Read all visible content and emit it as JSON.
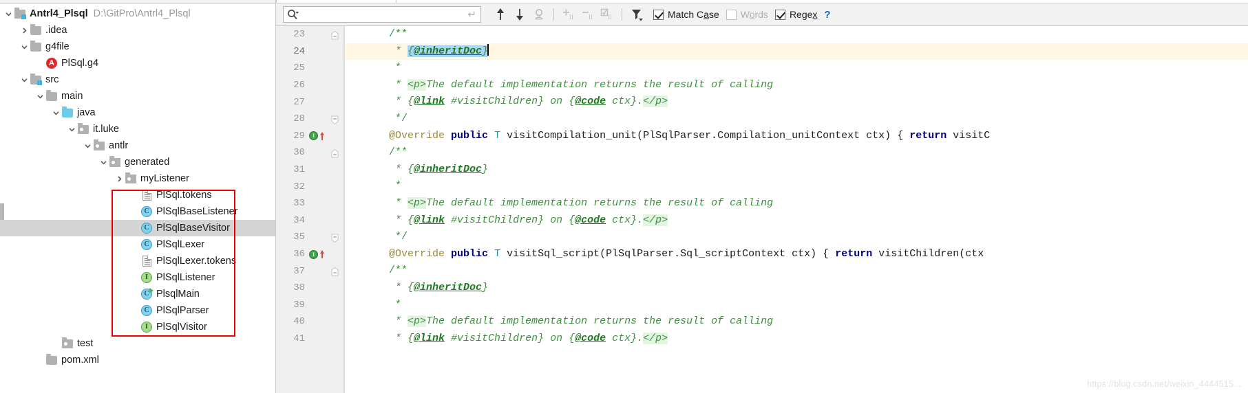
{
  "sidebar": {
    "tree": [
      {
        "depth": 0,
        "twisty": "expanded",
        "icon": "module-icon",
        "label": "Antrl4_Plsql",
        "bold": true,
        "path": "D:\\GitPro\\Antrl4_Plsql",
        "selected": false
      },
      {
        "depth": 1,
        "twisty": "collapsed",
        "icon": "folder-icon",
        "label": ".idea",
        "bold": false,
        "path": "",
        "selected": false
      },
      {
        "depth": 1,
        "twisty": "expanded",
        "icon": "folder-icon",
        "label": "g4file",
        "bold": false,
        "path": "",
        "selected": false
      },
      {
        "depth": 2,
        "twisty": "none",
        "icon": "antlr-file-icon",
        "label": "PlSql.g4",
        "bold": false,
        "path": "",
        "selected": false
      },
      {
        "depth": 1,
        "twisty": "expanded",
        "icon": "source-folder-icon",
        "label": "src",
        "bold": false,
        "path": "",
        "selected": false
      },
      {
        "depth": 2,
        "twisty": "expanded",
        "icon": "folder-icon",
        "label": "main",
        "bold": false,
        "path": "",
        "selected": false
      },
      {
        "depth": 3,
        "twisty": "expanded",
        "icon": "java-source-folder-icon",
        "label": "java",
        "bold": false,
        "path": "",
        "selected": false
      },
      {
        "depth": 4,
        "twisty": "expanded",
        "icon": "package-icon",
        "label": "it.luke",
        "bold": false,
        "path": "",
        "selected": false
      },
      {
        "depth": 5,
        "twisty": "expanded",
        "icon": "package-icon",
        "label": "antlr",
        "bold": false,
        "path": "",
        "selected": false
      },
      {
        "depth": 6,
        "twisty": "expanded",
        "icon": "package-icon",
        "label": "generated",
        "bold": false,
        "path": "",
        "selected": false
      },
      {
        "depth": 7,
        "twisty": "collapsed",
        "icon": "package-icon",
        "label": "myListener",
        "bold": false,
        "path": "",
        "selected": false
      },
      {
        "depth": 8,
        "twisty": "none",
        "icon": "tokens-file-icon",
        "label": "PlSql.tokens",
        "bold": false,
        "path": "",
        "selected": false
      },
      {
        "depth": 8,
        "twisty": "none",
        "icon": "java-class-icon",
        "label": "PlSqlBaseListener",
        "bold": false,
        "path": "",
        "selected": false
      },
      {
        "depth": 8,
        "twisty": "none",
        "icon": "java-class-icon",
        "label": "PlSqlBaseVisitor",
        "bold": false,
        "path": "",
        "selected": true
      },
      {
        "depth": 8,
        "twisty": "none",
        "icon": "java-class-icon",
        "label": "PlSqlLexer",
        "bold": false,
        "path": "",
        "selected": false
      },
      {
        "depth": 8,
        "twisty": "none",
        "icon": "tokens-file-icon",
        "label": "PlSqlLexer.tokens",
        "bold": false,
        "path": "",
        "selected": false
      },
      {
        "depth": 8,
        "twisty": "none",
        "icon": "java-interface-icon",
        "label": "PlSqlListener",
        "bold": false,
        "path": "",
        "selected": false
      },
      {
        "depth": 8,
        "twisty": "none",
        "icon": "java-runnable-class-icon",
        "label": "PlsqlMain",
        "bold": false,
        "path": "",
        "selected": false
      },
      {
        "depth": 8,
        "twisty": "none",
        "icon": "java-class-icon",
        "label": "PlSqlParser",
        "bold": false,
        "path": "",
        "selected": false
      },
      {
        "depth": 8,
        "twisty": "none",
        "icon": "java-interface-icon",
        "label": "PlSqlVisitor",
        "bold": false,
        "path": "",
        "selected": false
      },
      {
        "depth": 3,
        "twisty": "none",
        "icon": "package-icon",
        "label": "test",
        "bold": false,
        "path": "",
        "selected": false
      },
      {
        "depth": 2,
        "twisty": "none",
        "icon": "folder-icon",
        "label": "pom.xml",
        "bold": false,
        "path": "",
        "selected": false
      }
    ],
    "highlight_box_color": "#f00000"
  },
  "find_toolbar": {
    "search_value": "",
    "search_placeholder": "",
    "icons": {
      "magnifier": "search-icon",
      "dropdown": "chevron-down-icon",
      "enter_hint": "enter-key-icon",
      "prev": "arrow-up-icon",
      "next": "arrow-down-icon",
      "select_all": "select-all-occurrences-icon",
      "add_line": "add-selection-icon",
      "remove_line": "remove-selection-icon",
      "select_lines": "select-all-lines-icon",
      "filter": "filter-icon"
    },
    "options": [
      {
        "name": "match-case",
        "label": "Match C̲ase",
        "label_pre": "Match C",
        "label_underline": "a",
        "label_post": "se",
        "checked": true
      },
      {
        "name": "words",
        "label": "W̲ords",
        "label_pre": "W",
        "label_underline": "o",
        "label_post": "rds",
        "checked": false
      },
      {
        "name": "regex",
        "label": "Rege̲x",
        "label_pre": "Rege",
        "label_underline": "x",
        "label_post": "",
        "checked": true
      }
    ],
    "help_label": "?"
  },
  "editor": {
    "first_line_number": 23,
    "current_line_number": 24,
    "lines": [
      {
        "n": 23,
        "fold": "end",
        "marks": [],
        "current": false
      },
      {
        "n": 24,
        "fold": "none",
        "marks": [],
        "current": true
      },
      {
        "n": 25,
        "fold": "none",
        "marks": [],
        "current": false
      },
      {
        "n": 26,
        "fold": "none",
        "marks": [],
        "current": false
      },
      {
        "n": 27,
        "fold": "none",
        "marks": [],
        "current": false
      },
      {
        "n": 28,
        "fold": "start",
        "marks": [],
        "current": false
      },
      {
        "n": 29,
        "fold": "none",
        "marks": [
          "override-method-icon",
          "override-arrow-icon"
        ],
        "current": false
      },
      {
        "n": 30,
        "fold": "end",
        "marks": [],
        "current": false
      },
      {
        "n": 31,
        "fold": "none",
        "marks": [],
        "current": false
      },
      {
        "n": 32,
        "fold": "none",
        "marks": [],
        "current": false
      },
      {
        "n": 33,
        "fold": "none",
        "marks": [],
        "current": false
      },
      {
        "n": 34,
        "fold": "none",
        "marks": [],
        "current": false
      },
      {
        "n": 35,
        "fold": "start",
        "marks": [],
        "current": false
      },
      {
        "n": 36,
        "fold": "none",
        "marks": [
          "override-method-icon",
          "override-arrow-icon"
        ],
        "current": false
      },
      {
        "n": 37,
        "fold": "end",
        "marks": [],
        "current": false
      },
      {
        "n": 38,
        "fold": "none",
        "marks": [],
        "current": false
      },
      {
        "n": 39,
        "fold": "none",
        "marks": [],
        "current": false
      },
      {
        "n": 40,
        "fold": "none",
        "marks": [],
        "current": false
      },
      {
        "n": 41,
        "fold": "none",
        "marks": [],
        "current": false
      }
    ],
    "code_text": [
      "    /**",
      "     * {@inheritDoc}",
      "     *",
      "     * <p>The default implementation returns the result of calling",
      "     * {@link #visitChildren} on {@code ctx}.</p>",
      "     */",
      "    @Override public T visitCompilation_unit(PlSqlParser.Compilation_unitContext ctx) { return visitC",
      "    /**",
      "     * {@inheritDoc}",
      "     *",
      "     * <p>The default implementation returns the result of calling",
      "     * {@link #visitChildren} on {@code ctx}.</p>",
      "     */",
      "    @Override public T visitSql_script(PlSqlParser.Sql_scriptContext ctx) { return visitChildren(ctx",
      "    /**",
      "     * {@inheritDoc}",
      "     *",
      "     * <p>The default implementation returns the result of calling",
      "     * {@link #visitChildren} on {@code ctx}.</p>"
    ],
    "selection_text": "{@inheritDoc}",
    "colors": {
      "comment": "#3f8f3f",
      "keyword": "#000080",
      "type": "#20999d",
      "annotation": "#9b8a3a",
      "current_line_bg": "#fdf7e3",
      "selection_bg": "#a8d4f5",
      "html_tag_bg": "#e2f5e0"
    }
  },
  "watermark": "https://blog.csdn.net/weixin_4444515..."
}
